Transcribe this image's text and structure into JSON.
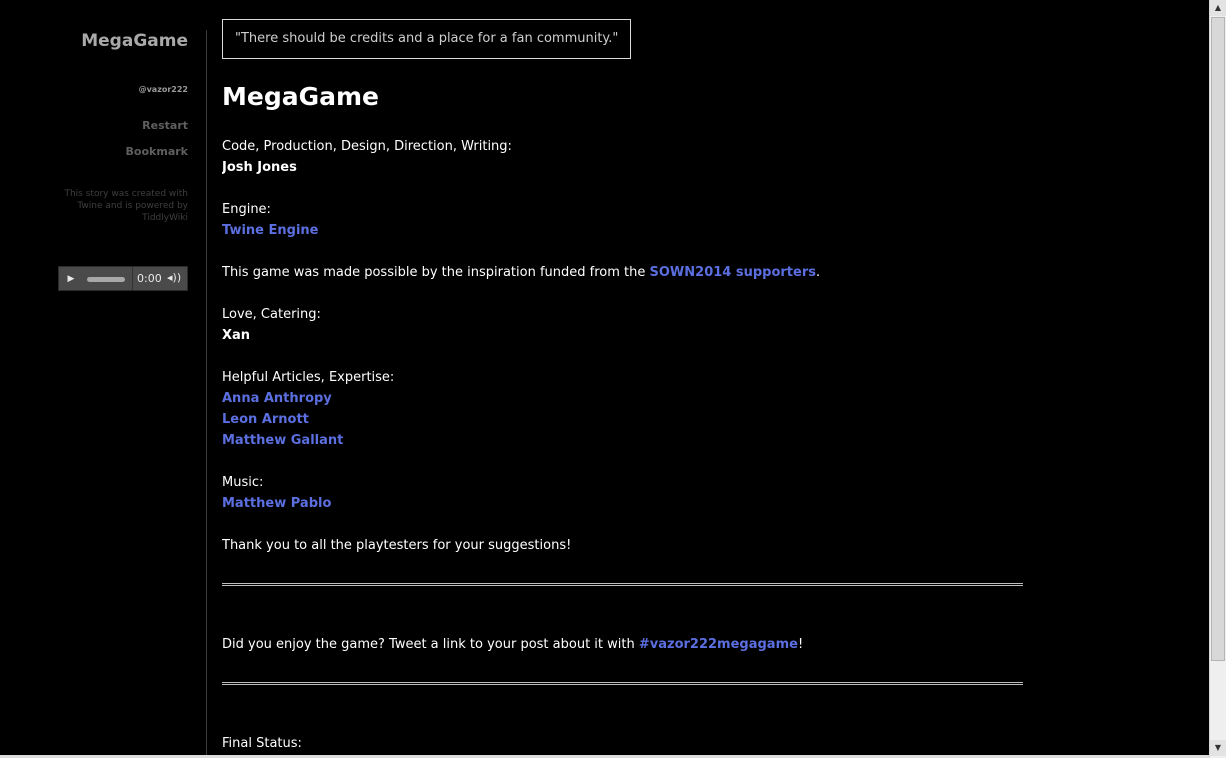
{
  "sidebar": {
    "title": "MegaGame",
    "author": "@vazor222",
    "restart": "Restart",
    "bookmark": "Bookmark",
    "credit": "This story was created with Twine and is powered by TiddlyWiki"
  },
  "audio": {
    "time": "0:00",
    "play_glyph": "▶",
    "volume_glyph": "🔊"
  },
  "main": {
    "quote": "\"There should be credits and a place for a fan community.\"",
    "title": "MegaGame",
    "code_label": "Code, Production, Design, Direction, Writing:",
    "code_name": "Josh Jones",
    "engine_label": "Engine:",
    "engine_link": "Twine Engine",
    "inspiration_pre": "This game was made possible by the inspiration funded from the ",
    "inspiration_link": "SOWN2014 supporters",
    "inspiration_post": ".",
    "love_label": "Love, Catering:",
    "love_name": "Xan",
    "articles_label": "Helpful Articles, Expertise:",
    "articles": [
      "Anna Anthropy",
      "Leon Arnott",
      "Matthew Gallant"
    ],
    "music_label": "Music:",
    "music_link": "Matthew Pablo",
    "thanks": "Thank you to all the playtesters for your suggestions!",
    "tweet_pre": "Did you enjoy the game? Tweet a link to your post about it with ",
    "tweet_link": "#vazor222megagame",
    "tweet_post": "!",
    "final_status": "Final Status:"
  },
  "colors": {
    "background": "#000000",
    "link": "#5b6fe0",
    "sidebar_title": "#a9a9a9"
  },
  "scrollbar": {
    "up": "▲",
    "down": "▼"
  }
}
